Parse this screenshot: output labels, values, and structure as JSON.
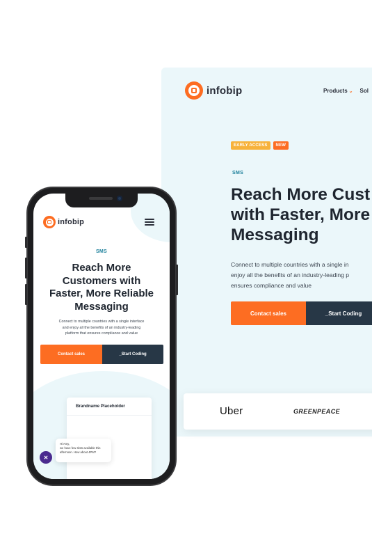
{
  "desktop": {
    "logo_text": "infobip",
    "nav": [
      {
        "label": "Products",
        "chevron": "⌄"
      },
      {
        "label": "Sol"
      }
    ],
    "badges": {
      "early_access": "EARLY ACCESS",
      "new": "NEW"
    },
    "eyebrow": "SMS",
    "headline": "Reach More Cust\nwith Faster, More\nMessaging",
    "body": "Connect to multiple countries with a single in\nenjoy all the benefits of an industry-leading p\nensures compliance and value",
    "buttons": {
      "contact": "Contact sales",
      "start": "_Start Coding"
    },
    "logos": [
      "Uber",
      "GREENPEACE"
    ]
  },
  "mobile": {
    "logo_text": "infobip",
    "menu_icon": "hamburger-icon",
    "eyebrow": "SMS",
    "headline": "Reach More\nCustomers with\nFaster, More Reliable\nMessaging",
    "body": "Connect to multiple countries with a single interface\nand enjoy all the benefits of an industry-leading\nplatform that ensures compliance and value",
    "buttons": {
      "contact": "Contact sales",
      "start": "_Start Coding"
    },
    "card_title": "Brandname Placeholder",
    "chat_message": "Hi Amy,\nwe have few slots available this\nafternoon. How about 4PM?",
    "chat_avatar_icon": "x-logo-icon"
  },
  "colors": {
    "brand_orange": "#fd6d22",
    "dark_button": "#273746",
    "light_bg": "#ebf7fa",
    "teal_text": "#1b7f9a",
    "badge_yellow": "#f7b23b"
  }
}
